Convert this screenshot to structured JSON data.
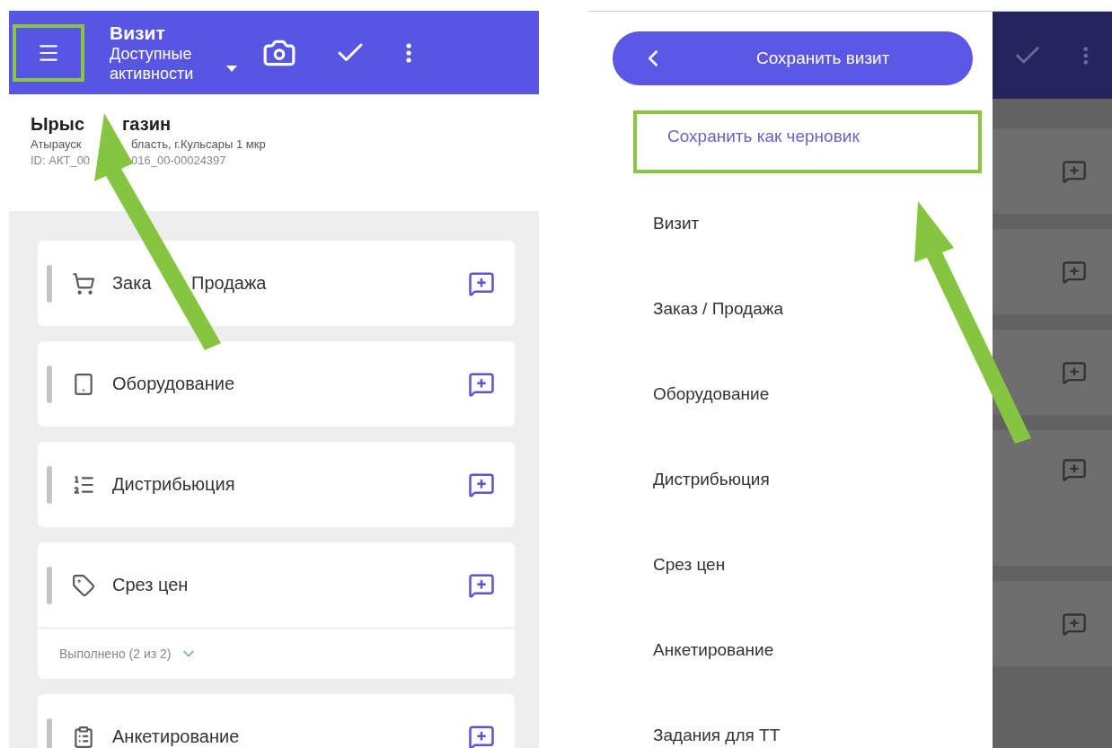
{
  "header": {
    "title": "Визит",
    "subtitle": "Доступные активности",
    "menu_highlighted": true
  },
  "store": {
    "name": [
      "Ырыс",
      "газин"
    ],
    "address": [
      "Атырауск",
      "бласть, г.Кульсары 1 мкр"
    ],
    "id": [
      "ID: АКТ_00",
      "016_00-00024397"
    ]
  },
  "activities": [
    {
      "label": [
        "Зака",
        "Продажа"
      ]
    },
    {
      "label": [
        "Оборудование"
      ]
    },
    {
      "label": [
        "Дистрибьюция"
      ]
    },
    {
      "label": [
        "Срез цен"
      ],
      "footer": {
        "text": "Выполнено (2 из 2)",
        "expanded": false
      }
    },
    {
      "label": [
        "Анкетирование"
      ]
    }
  ],
  "drawer": {
    "back_button": "Сохранить визит",
    "items": [
      {
        "label": "Сохранить как черновик",
        "kind": "action",
        "highlighted": true
      },
      {
        "label": "Визит",
        "kind": "section",
        "highlighted": false
      },
      {
        "label": "Заказ / Продажа",
        "kind": "section",
        "highlighted": false
      },
      {
        "label": "Оборудование",
        "kind": "section",
        "highlighted": false
      },
      {
        "label": "Дистрибьюция",
        "kind": "section",
        "highlighted": false
      },
      {
        "label": "Срез цен",
        "kind": "section",
        "highlighted": false
      },
      {
        "label": "Анкетирование",
        "kind": "section",
        "highlighted": false
      },
      {
        "label": "Задания для ТТ",
        "kind": "section",
        "highlighted": false
      }
    ]
  }
}
